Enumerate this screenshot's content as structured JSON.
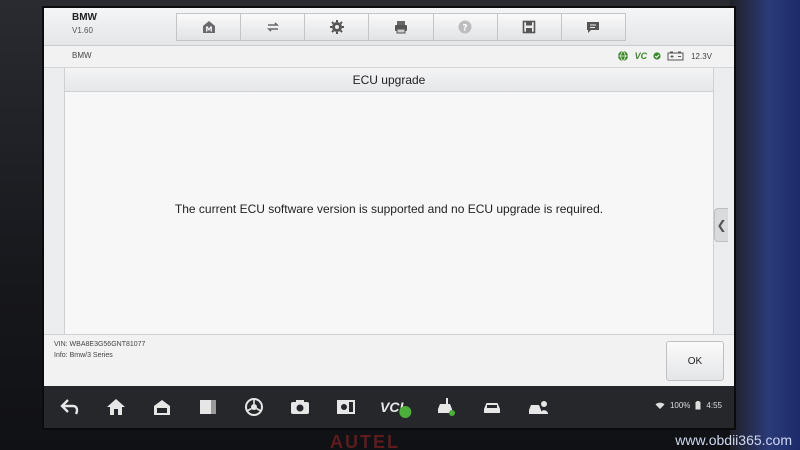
{
  "app": {
    "title": "BMW",
    "version": "V1.60"
  },
  "toolbar": {
    "buttons": [
      {
        "name": "home-button",
        "icon": "m-home-icon"
      },
      {
        "name": "vehicle-button",
        "icon": "car-switch-icon"
      },
      {
        "name": "settings-button",
        "icon": "gear-icon"
      },
      {
        "name": "print-button",
        "icon": "printer-icon"
      },
      {
        "name": "help-button",
        "icon": "question-icon"
      },
      {
        "name": "save-button",
        "icon": "save-icon"
      },
      {
        "name": "message-button",
        "icon": "chat-icon"
      }
    ]
  },
  "breadcrumb": {
    "label": "BMW"
  },
  "status": {
    "vci": "VC",
    "voltage": "12.3V"
  },
  "dialog": {
    "title": "ECU upgrade",
    "message": "The current ECU software version is supported and no ECU upgrade is required."
  },
  "footer": {
    "vin": "VIN: WBA8E3G56GNT81077",
    "info": "Info: Bmw/3 Series",
    "ok_label": "OK"
  },
  "navbar": {
    "vci_label": "VCI",
    "battery": "100%",
    "time": "4:55"
  },
  "device": {
    "brand": "AUTEL"
  },
  "watermark": "www.obdii365.com",
  "colors": {
    "accent_green": "#3a8a2a",
    "nav_bg": "#26272b"
  }
}
